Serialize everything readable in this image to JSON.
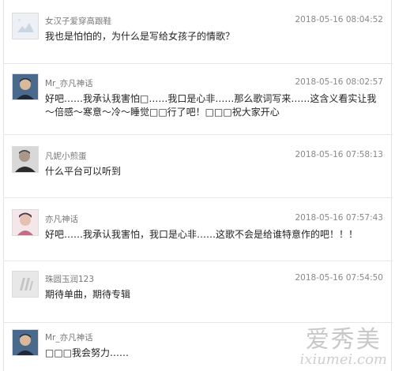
{
  "comments": [
    {
      "user": "女汉子爱穿高跟鞋",
      "time": "2018-05-16 08:04:52",
      "text": "我也是怕怕的，为什么是写给女孩子的情歌？"
    },
    {
      "user": "Mr_亦凡神话",
      "time": "2018-05-16 08:02:57",
      "text": "好吧……我承认我害怕□……我口是心非……那么歌词写来……这含义看实让我～倍感～寒意～冷～睡觉□□行了吧！□□□祝大家开心"
    },
    {
      "user": "凡妮小煎蛋",
      "time": "2018-05-16 07:58:13",
      "text": "什么平台可以听到"
    },
    {
      "user": "亦凡神话",
      "time": "2018-05-16 07:57:43",
      "text": "好吧……我承认我害怕，我口是心非……这歌不会是给谁特意作的吧！！！"
    },
    {
      "user": "珠圆玉润123",
      "time": "2018-05-16 07:54:50",
      "text": "期待单曲，期待专辑"
    },
    {
      "user": "Mr_亦凡神话",
      "time": "",
      "text": "□□□我会努力……"
    }
  ],
  "watermark": {
    "main": "爱秀美",
    "sub": "ixiumei.com"
  },
  "colors": {
    "text": "#222222",
    "meta": "#888888",
    "divider": "#e6e6e6"
  }
}
